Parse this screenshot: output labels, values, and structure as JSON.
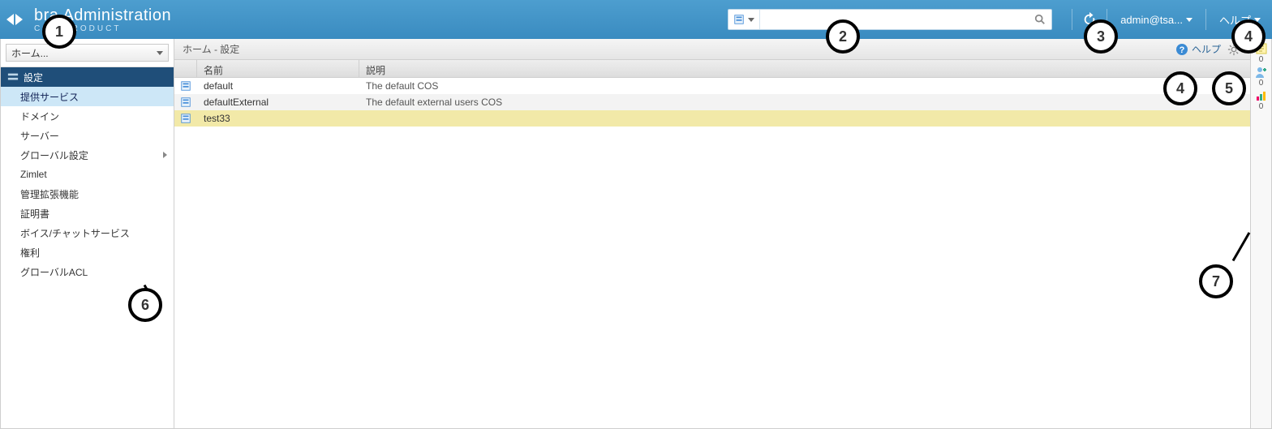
{
  "brand": {
    "title": "bra Administration",
    "subtitle": "COR PRODUCT"
  },
  "search": {
    "placeholder": "",
    "value": ""
  },
  "user_label": "admin@tsa...",
  "top_help_label": "ヘルプ",
  "home_selector": "ホーム...",
  "sidebar": {
    "section_label": "設定",
    "items": [
      {
        "label": "提供サービス",
        "selected": true,
        "has_children": false
      },
      {
        "label": "ドメイン",
        "selected": false,
        "has_children": false
      },
      {
        "label": "サーバー",
        "selected": false,
        "has_children": false
      },
      {
        "label": "グローバル設定",
        "selected": false,
        "has_children": true
      },
      {
        "label": "Zimlet",
        "selected": false,
        "has_children": false
      },
      {
        "label": "管理拡張機能",
        "selected": false,
        "has_children": false
      },
      {
        "label": "証明書",
        "selected": false,
        "has_children": false
      },
      {
        "label": "ボイス/チャットサービス",
        "selected": false,
        "has_children": false
      },
      {
        "label": "権利",
        "selected": false,
        "has_children": false
      },
      {
        "label": "グローバルACL",
        "selected": false,
        "has_children": false
      }
    ]
  },
  "breadcrumb": "ホーム - 設定",
  "content_help_label": "ヘルプ",
  "columns": {
    "name": "名前",
    "description": "説明"
  },
  "rows": [
    {
      "name": "default",
      "description": "The default COS",
      "selected": false
    },
    {
      "name": "defaultExternal",
      "description": "The default external users COS",
      "selected": false
    },
    {
      "name": "test33",
      "description": "",
      "selected": true
    }
  ],
  "rail_counts": [
    "0",
    "0",
    "0"
  ],
  "annotations": {
    "1": "1",
    "2": "2",
    "3": "3",
    "4": "4",
    "5": "5",
    "6": "6",
    "7": "7"
  }
}
